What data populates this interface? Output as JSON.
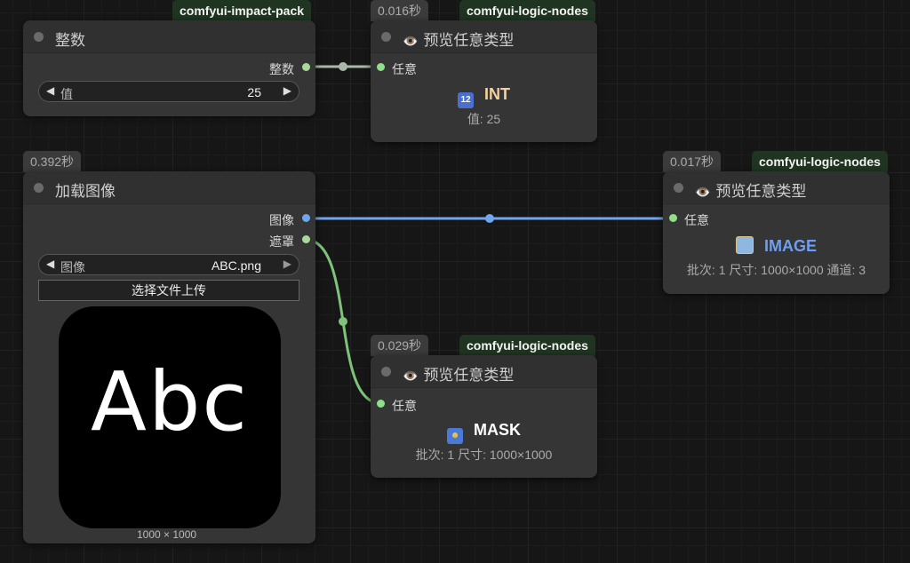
{
  "colors": {
    "int_link": "#a9b8a8",
    "image_link": "#6ea6f0",
    "mask_link": "#7fc27a",
    "int_type": "#f5d29a",
    "image_type": "#6f9ef0",
    "mask_type": "#ffffff"
  },
  "nodes": {
    "integer": {
      "source": "comfyui-impact-pack",
      "title": "整数",
      "output_label": "整数",
      "widget_label": "值",
      "widget_value": "25"
    },
    "preview_int": {
      "time": "0.016秒",
      "source": "comfyui-logic-nodes",
      "title": "预览任意类型",
      "input_label": "任意",
      "type": "INT",
      "info": "值: 25"
    },
    "load_image": {
      "time": "0.392秒",
      "title": "加载图像",
      "output_image_label": "图像",
      "output_mask_label": "遮罩",
      "widget_label": "图像",
      "widget_value": "ABC.png",
      "upload_label": "选择文件上传",
      "preview_text": "Abc",
      "dimensions": "1000 × 1000"
    },
    "preview_image": {
      "time": "0.017秒",
      "source": "comfyui-logic-nodes",
      "title": "预览任意类型",
      "input_label": "任意",
      "type": "IMAGE",
      "info": "批次: 1  尺寸: 1000×1000  通道: 3"
    },
    "preview_mask": {
      "time": "0.029秒",
      "source": "comfyui-logic-nodes",
      "title": "预览任意类型",
      "input_label": "任意",
      "type": "MASK",
      "info": "批次: 1  尺寸: 1000×1000"
    }
  },
  "icons": {
    "eye": "eye-icon",
    "int": "numbers-icon",
    "image": "picture-icon",
    "mask": "theater-masks-icon"
  }
}
